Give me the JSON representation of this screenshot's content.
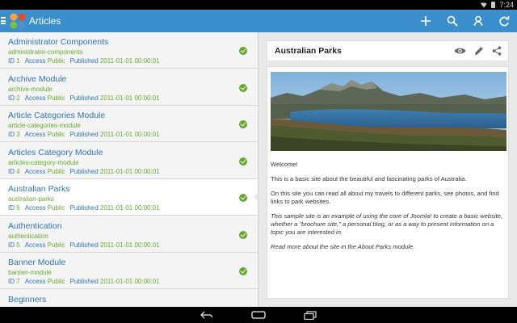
{
  "status_bar": {
    "time": "7:24"
  },
  "action_bar": {
    "title": "Articles",
    "icons": [
      "add-icon",
      "search-icon",
      "user-search-icon",
      "refresh-icon"
    ]
  },
  "list": {
    "labels": {
      "id": "ID",
      "access": "Access",
      "published": "Published"
    },
    "items": [
      {
        "title": "Administrator Components",
        "alias": "administrator-components",
        "id": "1",
        "access": "Public",
        "date": "2011-01-01 00:00:01",
        "selected": false
      },
      {
        "title": "Archive Module",
        "alias": "archive-module",
        "id": "2",
        "access": "Public",
        "date": "2011-01-01 00:00:01",
        "selected": false
      },
      {
        "title": "Article Categories Module",
        "alias": "article-categories-module",
        "id": "3",
        "access": "Public",
        "date": "2011-01-01 00:00:01",
        "selected": false
      },
      {
        "title": "Articles Category Module",
        "alias": "articles-category-module",
        "id": "4",
        "access": "Public",
        "date": "2011-01-01 00:00:01",
        "selected": false
      },
      {
        "title": "Australian Parks",
        "alias": "australian-parks",
        "id": "6",
        "access": "Public",
        "date": "2011-01-01 00:00:01",
        "selected": true
      },
      {
        "title": "Authentication",
        "alias": "authentication",
        "id": "5",
        "access": "Public",
        "date": "2011-01-01 00:00:01",
        "selected": false
      },
      {
        "title": "Banner Module",
        "alias": "banner-module",
        "id": "7",
        "access": "Public",
        "date": "2011-01-01 00:00:01",
        "selected": false
      },
      {
        "title": "Beginners",
        "alias": "",
        "id": "",
        "access": "",
        "date": "",
        "selected": false
      }
    ]
  },
  "detail": {
    "title": "Australian Parks",
    "icons": [
      "eye-icon",
      "edit-pencil-icon",
      "share-icon"
    ],
    "paragraphs": [
      "Welcome!",
      "This is a basic site about the beautiful and fascinating parks of Australia.",
      "On this site you can read all about my travels to different parks, see photos, and find links to park websites.",
      "This sample site is an example of using the core of Joomla! to create a basic website, whether a \"brochure site,\" a personal blog, or as a way to present information on a topic you are interested in.",
      "Read more about the site in the About Parks module."
    ],
    "italic_from": 3
  },
  "nav_bar": {
    "icons": [
      "back-icon",
      "home-icon",
      "recent-apps-icon"
    ]
  },
  "colors": {
    "accent": "#3c8fcd",
    "link": "#2f74b5",
    "green": "#6aa832",
    "check": "#62a82f"
  }
}
